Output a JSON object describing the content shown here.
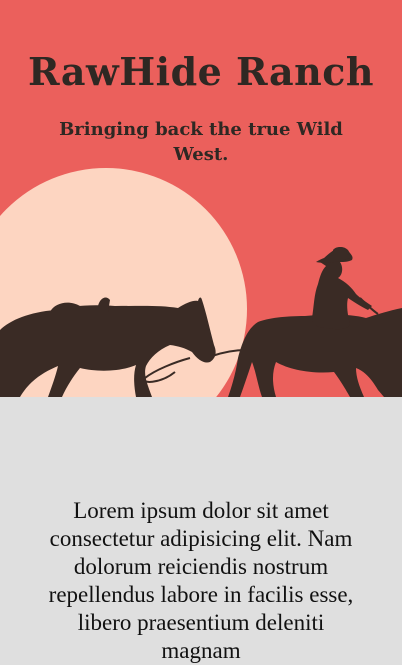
{
  "hero": {
    "title": "RawHide Ranch",
    "tagline": "Bringing back the true Wild West.",
    "colors": {
      "background": "#eb605c",
      "sun": "#fdd5c1",
      "silhouette": "#3a2b25",
      "text": "#2e2823"
    },
    "illustration": "horses-and-cowboy-silhouette"
  },
  "content": {
    "paragraph": "Lorem ipsum dolor sit amet consectetur adipisicing elit. Nam dolorum reiciendis nostrum repellendus labore in facilis esse, libero praesentium deleniti magnam"
  }
}
